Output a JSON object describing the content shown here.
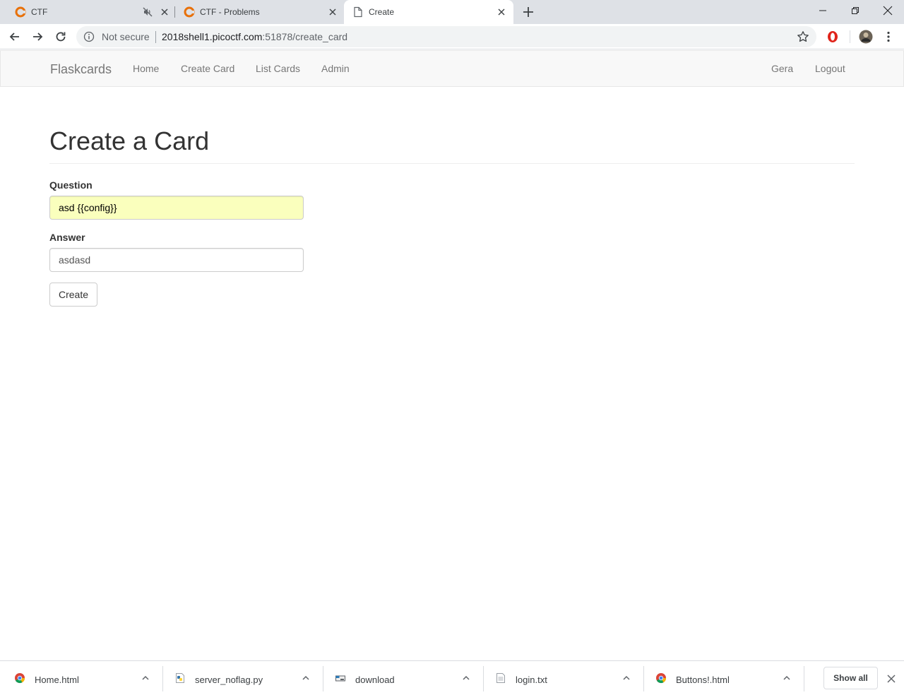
{
  "browser": {
    "tabs": [
      {
        "title": "CTF",
        "favicon": "picoctf-logo-icon",
        "muted": true
      },
      {
        "title": "CTF - Problems",
        "favicon": "picoctf-logo-icon"
      },
      {
        "title": "Create",
        "favicon": "page-icon",
        "active": true
      }
    ],
    "address": {
      "security_text": "Not secure",
      "host": "2018shell1.picoctf.com",
      "path": ":51878/create_card"
    }
  },
  "navbar": {
    "brand": "Flaskcards",
    "links": [
      "Home",
      "Create Card",
      "List Cards",
      "Admin"
    ],
    "right_links": [
      "Gera",
      "Logout"
    ]
  },
  "form": {
    "title": "Create a Card",
    "question_label": "Question",
    "question_value": "asd {{config}}",
    "answer_label": "Answer",
    "answer_value": "asdasd",
    "submit_label": "Create"
  },
  "downloads": {
    "items": [
      {
        "name": "Home.html",
        "icon": "chrome-icon"
      },
      {
        "name": "server_noflag.py",
        "icon": "python-file-icon"
      },
      {
        "name": "download",
        "icon": "file-icon"
      },
      {
        "name": "login.txt",
        "icon": "text-file-icon"
      },
      {
        "name": "Buttons!.html",
        "icon": "chrome-icon"
      }
    ],
    "show_all_label": "Show all"
  },
  "colors": {
    "autofill_bg": "#faffbd",
    "navbar_bg": "#f8f8f8",
    "tabstrip_bg": "#dee1e6",
    "opera_red": "#e0241b"
  }
}
